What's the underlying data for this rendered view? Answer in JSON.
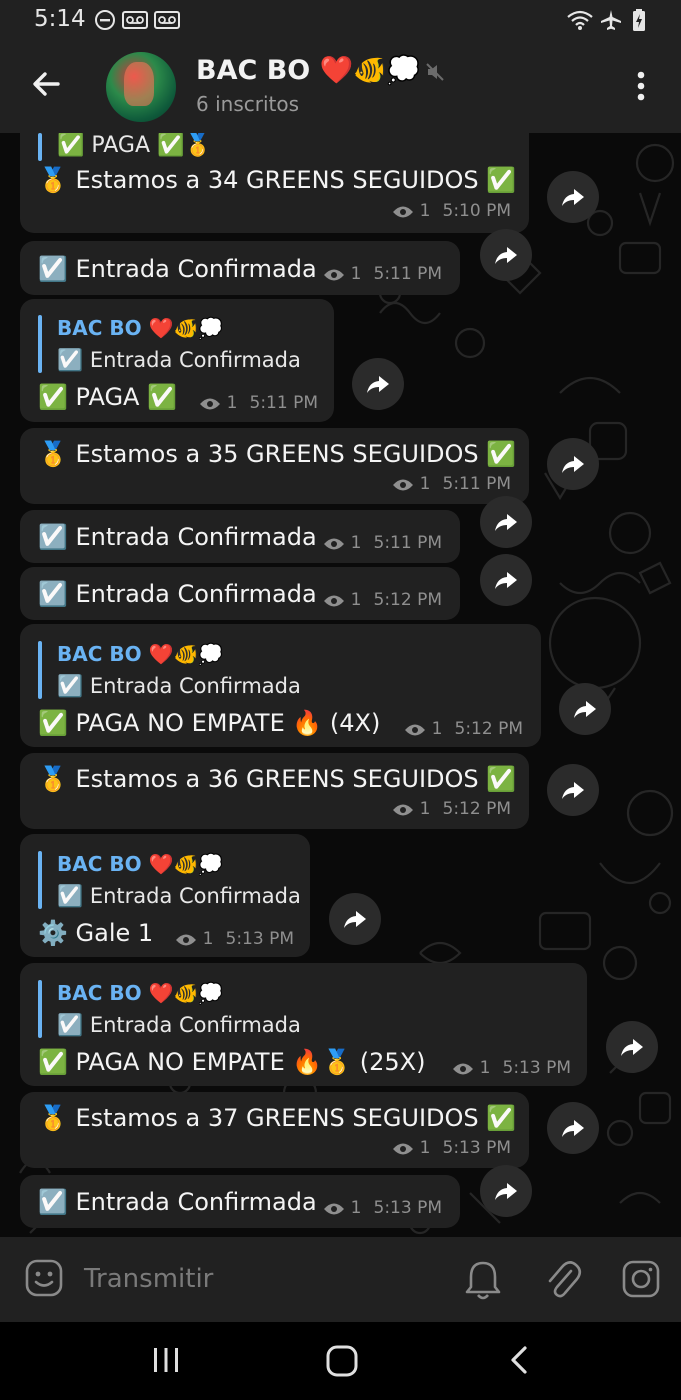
{
  "status_bar": {
    "time": "5:14"
  },
  "header": {
    "title": "BAC BO ❤️🐠💭",
    "subtitle": "6 inscritos"
  },
  "messages": [
    {
      "quote_text": "✅ PAGA ✅🥇",
      "text": "🥇 Estamos a 34 GREENS SEGUIDOS ✅",
      "views": "1",
      "time": "5:10 PM"
    },
    {
      "text": "☑️ Entrada Confirmada",
      "views": "1",
      "time": "5:11 PM"
    },
    {
      "quote_title": "BAC BO ❤️🐠💭",
      "quote_text": "☑️ Entrada Confirmada",
      "text": "✅ PAGA ✅",
      "views": "1",
      "time": "5:11 PM"
    },
    {
      "text": "🥇 Estamos a 35 GREENS SEGUIDOS ✅",
      "views": "1",
      "time": "5:11 PM"
    },
    {
      "text": "☑️ Entrada Confirmada",
      "views": "1",
      "time": "5:11 PM"
    },
    {
      "text": "☑️ Entrada Confirmada",
      "views": "1",
      "time": "5:12 PM"
    },
    {
      "quote_title": "BAC BO ❤️🐠💭",
      "quote_text": "☑️ Entrada Confirmada",
      "text": "✅ PAGA NO EMPATE 🔥 (4X)",
      "views": "1",
      "time": "5:12 PM"
    },
    {
      "text": "🥇 Estamos a 36 GREENS SEGUIDOS ✅",
      "views": "1",
      "time": "5:12 PM"
    },
    {
      "quote_title": "BAC BO ❤️🐠💭",
      "quote_text": "☑️ Entrada Confirmada",
      "text": "⚙️ Gale 1",
      "views": "1",
      "time": "5:13 PM"
    },
    {
      "quote_title": "BAC BO ❤️🐠💭",
      "quote_text": "☑️ Entrada Confirmada",
      "text": "✅ PAGA NO EMPATE 🔥🥇 (25X)",
      "views": "1",
      "time": "5:13 PM"
    },
    {
      "text": "🥇 Estamos a 37 GREENS SEGUIDOS ✅",
      "views": "1",
      "time": "5:13 PM"
    },
    {
      "text": "☑️ Entrada Confirmada",
      "views": "1",
      "time": "5:13 PM"
    }
  ],
  "input": {
    "placeholder": "Transmitir"
  },
  "icons": {
    "back": "back-arrow-icon",
    "mute": "muted-speaker-icon",
    "menu": "more-vert-icon",
    "views": "eye-icon",
    "share": "share-arrow-icon",
    "emoji": "emoji-icon",
    "bell": "bell-icon",
    "attach": "paperclip-icon",
    "camera": "instagram-camera-icon"
  },
  "colors": {
    "accent": "#6ab3f3",
    "bubble": "#212121",
    "header": "#212121",
    "background": "#0a0a0a"
  }
}
